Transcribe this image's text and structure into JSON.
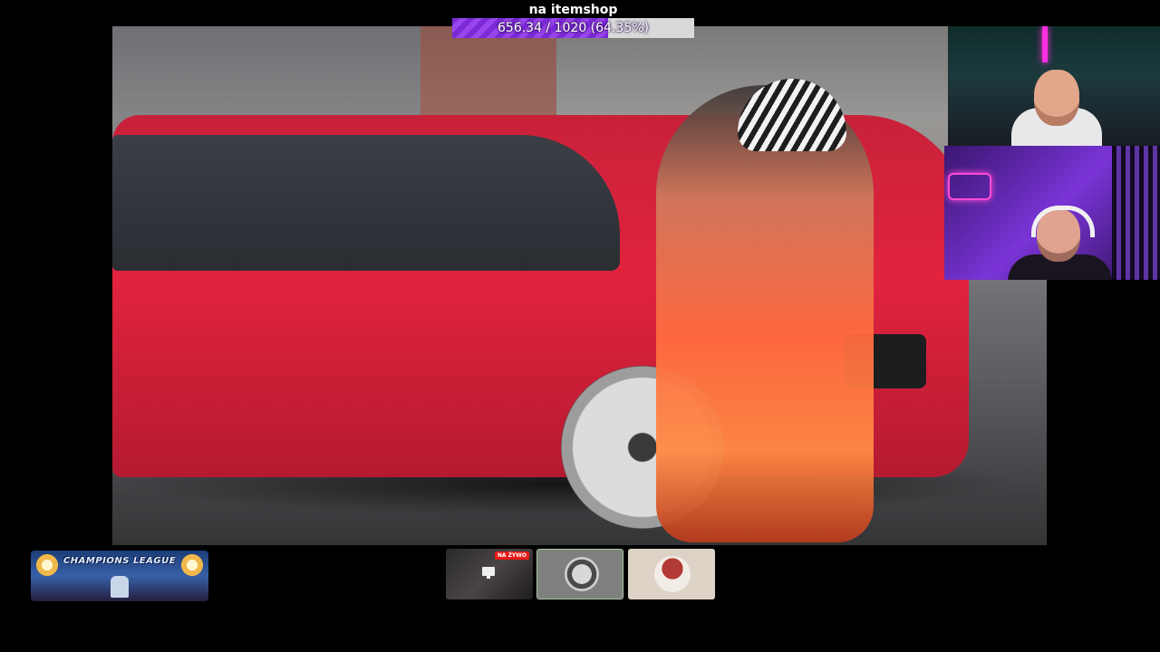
{
  "goal": {
    "title": "na itemshop",
    "progress_text": "656.34 / 1020 (64.35%)",
    "progress_fraction": 0.6435,
    "fill_color": "#8a3be2",
    "track_color": "#d9d9d9"
  },
  "thumbnails": {
    "live_badge": "NA ŻYWO"
  },
  "banner": {
    "text": "CHAMPIONS LEAGUE"
  },
  "icons": {
    "screen": "screen-icon"
  }
}
